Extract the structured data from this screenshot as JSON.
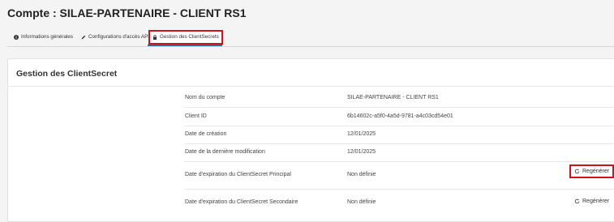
{
  "page": {
    "title": "Compte : SILAE-PARTENAIRE - CLIENT RS1"
  },
  "tabs": [
    {
      "label": "Informations générales",
      "icon": "info-circle-icon"
    },
    {
      "label": "Configurations d'accès API",
      "icon": "pencil-icon"
    },
    {
      "label": "Gestion des ClientSecrets",
      "icon": "lock-icon",
      "active": true
    }
  ],
  "card": {
    "title": "Gestion des ClientSecret"
  },
  "rows": [
    {
      "label": "Nom du compte",
      "value": "SILAE-PARTENAIRE - CLIENT RS1"
    },
    {
      "label": "Client ID",
      "value": "6b14602c-a5f0-4a5d-9781-a4c03cd54e01"
    },
    {
      "label": "Date de création",
      "value": "12/01/2025"
    },
    {
      "label": "Date de la dernière modification",
      "value": "12/01/2025"
    },
    {
      "label": "Date d'expiration du ClientSecret Principal",
      "value": "Non définie",
      "action": "Regénérer"
    },
    {
      "label": "Date d'expiration du ClientSecret Secondaire",
      "value": "Non définie",
      "action": "Regénérer"
    }
  ],
  "colors": {
    "highlight": "#d0121b",
    "active_tab_underline": "#1f6fb2"
  }
}
